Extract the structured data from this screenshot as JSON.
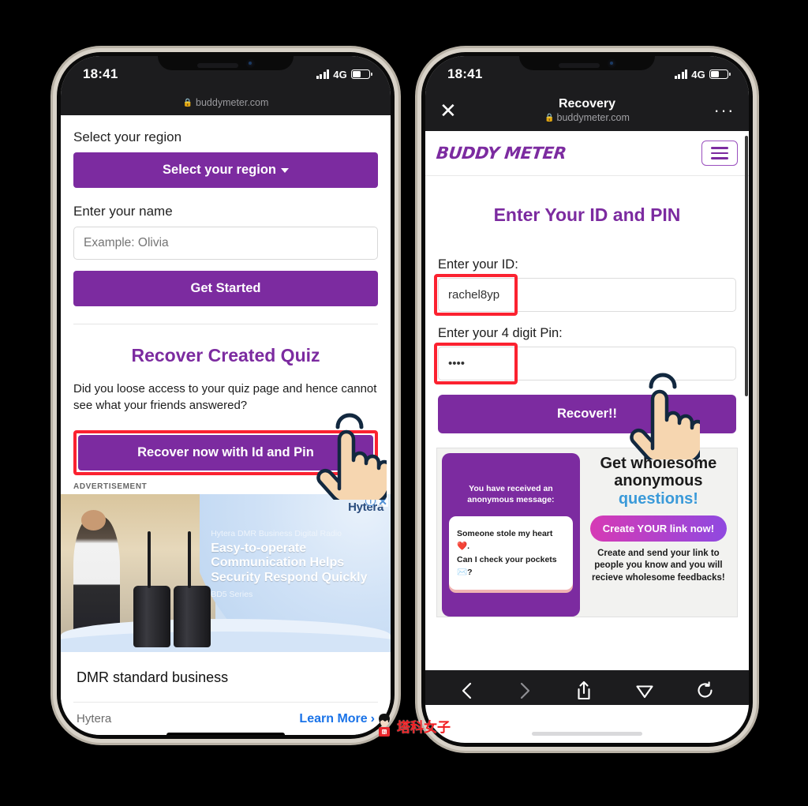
{
  "meta": {
    "accent_purple": "#7c2ba0",
    "highlight_red": "#fb2230",
    "link_blue": "#1a73e8"
  },
  "watermark": {
    "text": "塔科女子"
  },
  "left_phone": {
    "status": {
      "time": "18:41",
      "network": "4G",
      "signal_icon": "signal-bars-icon",
      "battery_icon": "battery-icon"
    },
    "url_bar": {
      "lock_icon": "lock-icon",
      "domain": "buddymeter.com"
    },
    "page": {
      "region_label": "Select your region",
      "region_button": "Select your region",
      "region_button_icon": "chevron-down-icon",
      "name_label": "Enter your name",
      "name_placeholder": "Example: Olivia",
      "name_value": "",
      "get_started_button": "Get Started",
      "recover_heading": "Recover Created Quiz",
      "recover_paragraph": "Did you loose access to your quiz page and hence cannot see what your friends answered?",
      "recover_button": "Recover now with Id and Pin"
    },
    "ad": {
      "label": "ADVERTISEMENT",
      "brand": "Hytera",
      "kicker": "Hytera DMR Business Digital Radio",
      "headline_line1": "Easy-to-operate",
      "headline_line2": "Communication Helps",
      "headline_line3": "Security Respond Quickly",
      "series": "BD5 Series",
      "adchoices_icon": "adchoices-info-icon",
      "close_icon": "close-icon",
      "title": "DMR standard business",
      "footer_brand": "Hytera",
      "cta": "Learn More",
      "cta_icon": "chevron-right-icon"
    }
  },
  "right_phone": {
    "status": {
      "time": "18:41",
      "network": "4G",
      "signal_icon": "signal-bars-icon",
      "battery_icon": "battery-icon"
    },
    "browser_bar": {
      "close_icon": "close-x-icon",
      "title": "Recovery",
      "lock_icon": "lock-icon",
      "domain": "buddymeter.com",
      "more_icon": "more-dots-icon"
    },
    "site_header": {
      "logo": "BUDDY METER",
      "menu_icon": "hamburger-menu-icon"
    },
    "page": {
      "heading": "Enter Your ID and PIN",
      "id_label": "Enter your ID:",
      "id_value": "rachel8yp",
      "pin_label": "Enter your 4 digit Pin:",
      "pin_value": "••••",
      "recover_button": "Recover!!"
    },
    "ad": {
      "phone_top_text": "You have received an anonymous message:",
      "card_line1": "Someone stole my heart❤️.",
      "card_line2": "Can I check your pockets✉️?",
      "headline_line1": "Get wholesome",
      "headline_line2": "anonymous",
      "headline_highlight": "questions!",
      "cta": "Create YOUR link now!",
      "subtext": "Create and send your link to people you know and you will recieve wholesome feedbacks!"
    },
    "toolbar": {
      "back_icon": "chevron-left-icon",
      "forward_icon": "chevron-right-icon",
      "share_icon": "share-up-icon",
      "send_icon": "paper-plane-icon",
      "reload_icon": "reload-icon"
    }
  }
}
